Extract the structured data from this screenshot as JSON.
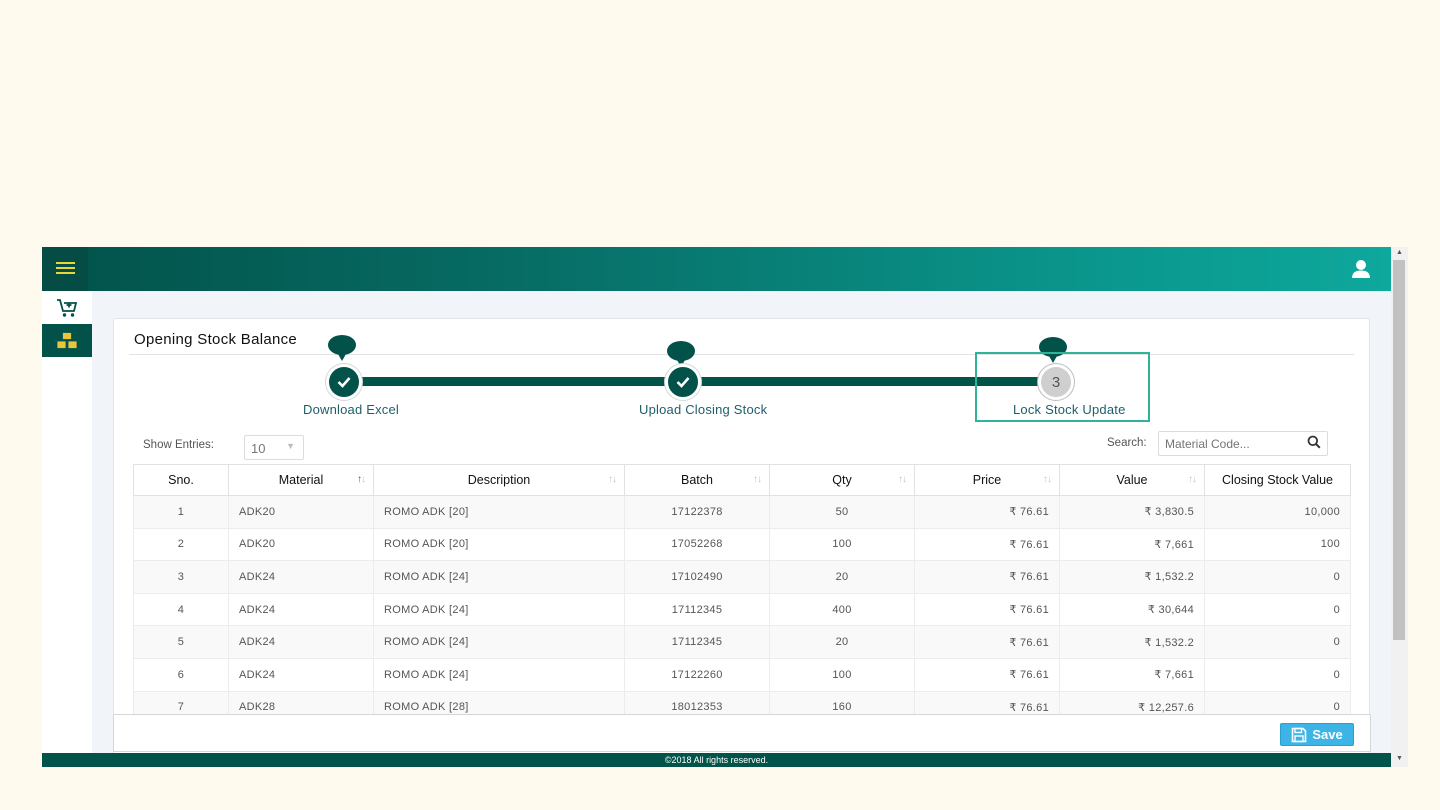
{
  "sidebar": {
    "items": [
      {
        "icon": "cart-icon",
        "active": false
      },
      {
        "icon": "boxes-icon",
        "active": true
      }
    ]
  },
  "page": {
    "title": "Opening Stock Balance"
  },
  "stepper": {
    "steps": [
      {
        "label": "Download Excel",
        "status": "done"
      },
      {
        "label": "Upload Closing Stock",
        "status": "done"
      },
      {
        "label": "Lock Stock Update",
        "status": "current",
        "number": "3"
      }
    ]
  },
  "table_controls": {
    "show_entries_label": "Show Entries:",
    "show_entries_value": "10",
    "search_label": "Search:",
    "search_placeholder": "Material Code..."
  },
  "table": {
    "headers": [
      "Sno.",
      "Material",
      "Description",
      "Batch",
      "Qty",
      "Price",
      "Value",
      "Closing Stock Value"
    ],
    "rows": [
      [
        "1",
        "ADK20",
        "ROMO ADK [20]",
        "17122378",
        "50",
        "₹ 76.61",
        "₹ 3,830.5",
        "10,000"
      ],
      [
        "2",
        "ADK20",
        "ROMO ADK [20]",
        "17052268",
        "100",
        "₹ 76.61",
        "₹ 7,661",
        "100"
      ],
      [
        "3",
        "ADK24",
        "ROMO ADK [24]",
        "17102490",
        "20",
        "₹ 76.61",
        "₹ 1,532.2",
        "0"
      ],
      [
        "4",
        "ADK24",
        "ROMO ADK [24]",
        "17112345",
        "400",
        "₹ 76.61",
        "₹ 30,644",
        "0"
      ],
      [
        "5",
        "ADK24",
        "ROMO ADK [24]",
        "17112345",
        "20",
        "₹ 76.61",
        "₹ 1,532.2",
        "0"
      ],
      [
        "6",
        "ADK24",
        "ROMO ADK [24]",
        "17122260",
        "100",
        "₹ 76.61",
        "₹ 7,661",
        "0"
      ],
      [
        "7",
        "ADK28",
        "ROMO ADK [28]",
        "18012353",
        "160",
        "₹ 76.61",
        "₹ 12,257.6",
        "0"
      ]
    ]
  },
  "actions": {
    "save_label": "Save"
  },
  "footer": {
    "copyright": "©2018 All rights reserved."
  },
  "colors": {
    "primary": "#02524a",
    "accent": "#0ea89c",
    "save": "#3db4e6",
    "highlight": "#2fb39a"
  }
}
